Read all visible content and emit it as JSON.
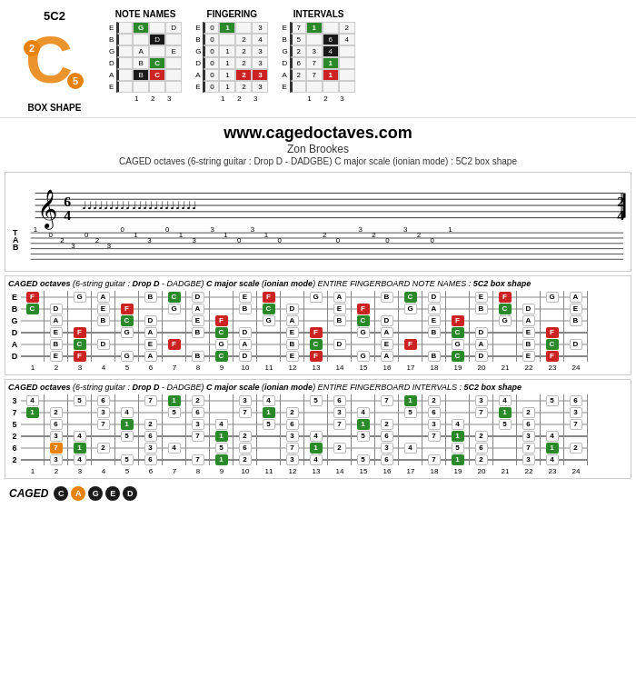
{
  "header": {
    "title": "5C2",
    "box_shape_label": "BOX SHAPE"
  },
  "website": {
    "url": "www.cagedoctaves.com",
    "author": "Zon Brookes",
    "description": "CAGED octaves (6-string guitar : Drop D - DADGBE) C major scale (ionian mode) : 5C2 box shape"
  },
  "diagrams": {
    "note_names": {
      "title": "NOTE NAMES",
      "strings": [
        "E",
        "B",
        "G",
        "D",
        "A",
        "E"
      ],
      "cells": [
        [
          "",
          "G",
          "",
          "D"
        ],
        [
          "",
          "",
          "",
          ""
        ],
        [
          "",
          "A",
          "",
          "E"
        ],
        [
          "",
          "B",
          "C",
          ""
        ],
        [
          "",
          "",
          "",
          ""
        ],
        [
          "",
          "",
          "",
          ""
        ]
      ]
    },
    "fingering": {
      "title": "FINGERING",
      "cells": [
        [
          "0",
          "1",
          "",
          "3"
        ],
        [
          "0",
          "",
          "2",
          "4"
        ],
        [
          "0",
          "1",
          "2",
          "3"
        ],
        [
          "0",
          "1",
          "2",
          "3"
        ],
        [
          "0",
          "1",
          "2",
          "3"
        ],
        [
          "0",
          "1",
          "2",
          "3"
        ]
      ]
    },
    "intervals": {
      "title": "INTERVALS",
      "cells": [
        [
          "7",
          "1",
          "",
          "2"
        ],
        [
          "5",
          "",
          "6",
          "4"
        ],
        [
          "2",
          "3",
          "4",
          ""
        ],
        [
          "6",
          "7",
          "1",
          ""
        ],
        [
          "2",
          "7",
          "1",
          ""
        ],
        [
          "",
          "",
          "",
          ""
        ]
      ]
    }
  },
  "fingerboard1": {
    "title_parts": [
      {
        "text": "CAGED octaves",
        "style": "italic-bold"
      },
      {
        "text": " (6-string guitar : ",
        "style": "normal"
      },
      {
        "text": "Drop D",
        "style": "bold-italic"
      },
      {
        "text": " - DADGBE) ",
        "style": "normal"
      },
      {
        "text": "C major scale",
        "style": "bold"
      },
      {
        "text": " (",
        "style": "normal"
      },
      {
        "text": "ionian mode",
        "style": "italic-bold"
      },
      {
        "text": ") ENTIRE FINGERBOARD NOTE NAMES : ",
        "style": "normal"
      },
      {
        "text": "5C2 box shape",
        "style": "bold"
      }
    ],
    "strings": [
      "E",
      "B",
      "G",
      "D",
      "A",
      "D"
    ],
    "fret_numbers": [
      1,
      2,
      3,
      4,
      5,
      6,
      7,
      8,
      9,
      10,
      11,
      12,
      13,
      14,
      15,
      16,
      17,
      18,
      19,
      20,
      21,
      22,
      23,
      24
    ],
    "rows": [
      {
        "label": "E",
        "notes": [
          "F",
          "",
          "G",
          "A",
          "",
          "B",
          "C",
          "D",
          "",
          "E",
          "F",
          "",
          "G",
          "A",
          "",
          "B",
          "C",
          "D",
          "",
          "E",
          "F",
          "",
          "G",
          "A"
        ]
      },
      {
        "label": "B",
        "notes": [
          "C",
          "D",
          "",
          "E",
          "F",
          "",
          "G",
          "A",
          "",
          "B",
          "C",
          "D",
          "",
          "E",
          "F",
          "",
          "G",
          "A",
          "",
          "B",
          "C",
          "D",
          "",
          "E"
        ]
      },
      {
        "label": "G",
        "notes": [
          "",
          "A",
          "",
          "B",
          "C",
          "D",
          "",
          "E",
          "F",
          "",
          "G",
          "A",
          "",
          "B",
          "C",
          "D",
          "",
          "E",
          "F",
          "",
          "G",
          "A",
          "",
          "B"
        ]
      },
      {
        "label": "D",
        "notes": [
          "",
          "E",
          "F",
          "",
          "G",
          "A",
          "",
          "B",
          "C",
          "D",
          "",
          "E",
          "F",
          "",
          "G",
          "A",
          "",
          "B",
          "C",
          "D",
          "",
          "E",
          "F",
          ""
        ]
      },
      {
        "label": "A",
        "notes": [
          "",
          "B",
          "C",
          "D",
          "",
          "E",
          "F",
          "",
          "G",
          "A",
          "",
          "B",
          "C",
          "D",
          "",
          "E",
          "F",
          "",
          "G",
          "A",
          "",
          "B",
          "C",
          "D"
        ]
      },
      {
        "label": "D",
        "notes": [
          "",
          "E",
          "F",
          "",
          "G",
          "A",
          "",
          "B",
          "C",
          "D",
          "",
          "E",
          "F",
          "",
          "G",
          "A",
          "",
          "B",
          "C",
          "D",
          "",
          "E",
          "F",
          ""
        ]
      }
    ],
    "highlighted": {
      "green": [
        [
          0,
          6
        ],
        [
          0,
          13
        ],
        [
          0,
          20
        ],
        [
          1,
          6
        ],
        [
          1,
          13
        ],
        [
          1,
          20
        ],
        [
          2,
          4
        ],
        [
          2,
          11
        ],
        [
          2,
          18
        ],
        [
          3,
          7
        ],
        [
          3,
          14
        ],
        [
          3,
          21
        ],
        [
          4,
          6
        ],
        [
          4,
          13
        ],
        [
          4,
          20
        ],
        [
          5,
          6
        ],
        [
          5,
          13
        ],
        [
          5,
          20
        ]
      ],
      "red": [
        [
          0,
          1
        ],
        [
          0,
          8
        ],
        [
          0,
          15
        ],
        [
          0,
          22
        ],
        [
          1,
          3
        ],
        [
          1,
          10
        ],
        [
          1,
          17
        ],
        [
          2,
          1
        ],
        [
          2,
          8
        ],
        [
          2,
          15
        ],
        [
          2,
          22
        ],
        [
          3,
          1
        ],
        [
          3,
          8
        ],
        [
          3,
          15
        ],
        [
          3,
          22
        ],
        [
          4,
          1
        ],
        [
          4,
          8
        ],
        [
          4,
          15
        ],
        [
          5,
          1
        ],
        [
          5,
          8
        ],
        [
          5,
          15
        ],
        [
          5,
          22
        ]
      ]
    }
  },
  "fingerboard2": {
    "title": "CAGED octaves (6-string guitar : Drop D - DADGBE) C major scale (ionian mode) ENTIRE FINGERBOARD INTERVALS : 5C2 box shape",
    "fret_numbers": [
      1,
      2,
      3,
      4,
      5,
      6,
      7,
      8,
      9,
      10,
      11,
      12,
      13,
      14,
      15,
      16,
      17,
      18,
      19,
      20,
      21,
      22,
      23,
      24
    ],
    "rows": [
      {
        "label": "3",
        "notes": [
          "4",
          "",
          "5",
          "6",
          "",
          "7",
          "1",
          "2",
          "",
          "3",
          "4",
          "",
          "5",
          "6",
          "",
          "7",
          "1",
          "2",
          "",
          "3",
          "4",
          "",
          "5",
          "6"
        ]
      },
      {
        "label": "7",
        "notes": [
          "1",
          "2",
          "",
          "3",
          "4",
          "",
          "5",
          "6",
          "",
          "7",
          "1",
          "2",
          "",
          "3",
          "4",
          "",
          "5",
          "6",
          "",
          "7",
          "1",
          "2",
          "",
          "3"
        ]
      },
      {
        "label": "5",
        "notes": [
          "",
          "6",
          "",
          "7",
          "1",
          "2",
          "",
          "3",
          "4",
          "",
          "5",
          "6",
          "",
          "7",
          "1",
          "2",
          "",
          "3",
          "4",
          "",
          "5",
          "6",
          "",
          "7"
        ]
      },
      {
        "label": "2",
        "notes": [
          "",
          "3",
          "4",
          "",
          "5",
          "6",
          "",
          "7",
          "1",
          "2",
          "",
          "3",
          "4",
          "",
          "5",
          "6",
          "",
          "7",
          "1",
          "2",
          "",
          "3",
          "4",
          ""
        ]
      },
      {
        "label": "6",
        "notes": [
          "",
          "7",
          "1",
          "2",
          "",
          "3",
          "4",
          "",
          "5",
          "6",
          "",
          "7",
          "1",
          "2",
          "",
          "3",
          "4",
          "",
          "5",
          "6",
          "",
          "7",
          "1",
          "2"
        ]
      },
      {
        "label": "2",
        "notes": [
          "",
          "3",
          "4",
          "",
          "5",
          "6",
          "",
          "7",
          "1",
          "2",
          "",
          "3",
          "4",
          "",
          "5",
          "6",
          "",
          "7",
          "1",
          "2",
          "",
          "3",
          "4",
          ""
        ]
      }
    ]
  },
  "caged_label": "CAGED"
}
